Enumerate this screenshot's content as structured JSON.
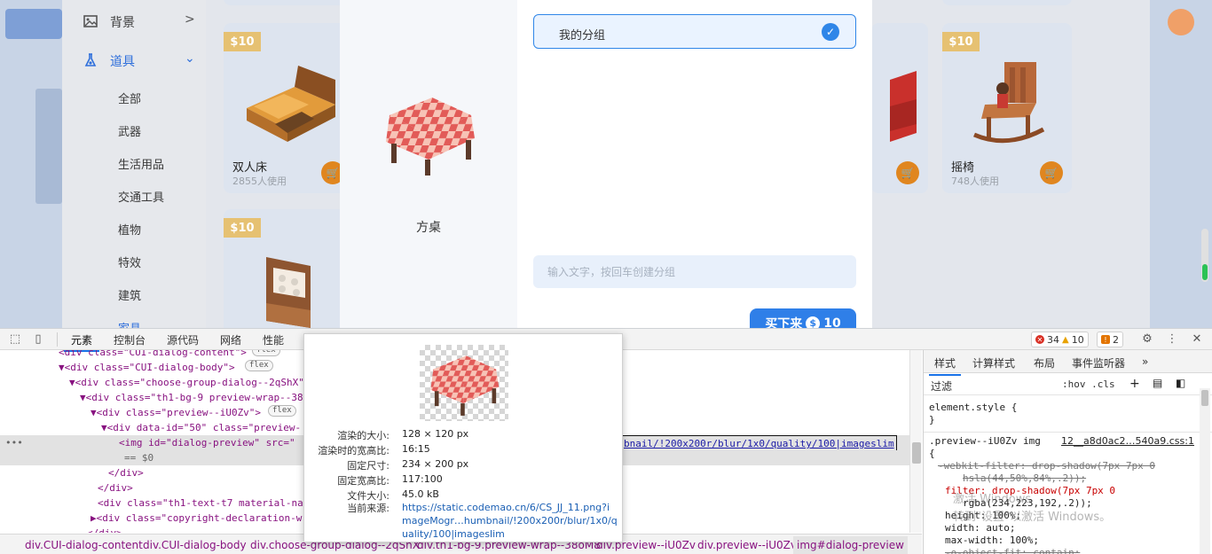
{
  "sidebar": {
    "items": [
      {
        "label": "背景",
        "icon": "image-icon"
      },
      {
        "label": "道具",
        "icon": "flask-icon"
      }
    ],
    "subitems": [
      "全部",
      "武器",
      "生活用品",
      "交通工具",
      "植物",
      "特效",
      "建筑",
      "家具"
    ]
  },
  "cards": [
    {
      "price": "$10",
      "name": "双人床",
      "users": "2855人使用"
    },
    {
      "price": "$10",
      "name": "",
      "users": ""
    },
    {
      "price": "$10",
      "name": "摇椅",
      "users": "748人使用"
    }
  ],
  "dialog": {
    "preview_title": "方桌",
    "group_label": "我的分组",
    "input_placeholder": "输入文字，按回车创建分组",
    "buy_label": "买下来",
    "buy_price": "10"
  },
  "devtools": {
    "tabs": [
      "元素",
      "控制台",
      "源代码",
      "网络",
      "性能"
    ],
    "errors": "34",
    "warnings": "10",
    "issues": "2",
    "dom_lines": [
      {
        "indent": 66,
        "html": "<div class=\"CUI-dialog-content\">",
        "badge": "flex"
      },
      {
        "indent": 66,
        "html": "▼<div class=\"CUI-dialog-body\">",
        "badge": "flex"
      },
      {
        "indent": 78,
        "html": "▼<div class=\"choose-group-dialog--2qShX\"",
        "badge": ""
      },
      {
        "indent": 90,
        "html": "▼<div class=\"th1-bg-9 preview-wrap--38",
        "badge": ""
      },
      {
        "indent": 102,
        "html": "▼<div class=\"preview--iU0Zv\">",
        "badge": "flex"
      },
      {
        "indent": 114,
        "html": "▼<div data-id=\"50\" class=\"preview-",
        "badge": ""
      },
      {
        "indent": 134,
        "html": "<img id=\"dialog-preview\" src=\"",
        "badge": ""
      },
      {
        "indent": 140,
        "html": "== $0",
        "badge": ""
      },
      {
        "indent": 122,
        "html": "</div>",
        "badge": ""
      },
      {
        "indent": 110,
        "html": "</div>",
        "badge": ""
      },
      {
        "indent": 110,
        "html": "<div class=\"th1-text-t7 material-nam",
        "badge": ""
      },
      {
        "indent": 102,
        "html": "▶<div class=\"copyright-declaration-w",
        "badge": ""
      },
      {
        "indent": 98,
        "html": "</div>",
        "badge": ""
      }
    ],
    "img_src_tail": "bnail/!200x200r/blur/1x0/quality/100|imageslim",
    "breadcrumb": [
      "div.CUI-dialog-content",
      "div.CUI-dialog-body",
      "div.choose-group-dialog--2qShX",
      "div.th1-bg-9.preview-wrap--38oM8",
      "div.preview--iU0Zv",
      "div.preview--iU0Zv",
      "img#dialog-preview"
    ],
    "styles_tabs": [
      "样式",
      "计算样式",
      "布局",
      "事件监听器"
    ],
    "filter_placeholder": "过滤",
    "hov_cls": ":hov  .cls",
    "element_style": "element.style {",
    "rule_selector": ".preview--iU0Zv img",
    "rule_source": "12__a8d0ac2…540a9.css:1",
    "css_lines": [
      "-webkit-filter: drop-shadow(7px 7px 0",
      "hsla(44,50%,84%,.2));",
      "filter: drop-shadow(7px 7px 0",
      "rgba(234,223,192,.2));",
      "height: 100%;",
      "width: auto;",
      "max-width: 100%;",
      "-o-object-fit: contain;"
    ],
    "watermark": "转到\"设置\"以激活 Windows。",
    "watermark_top": "激活 Windows"
  },
  "tooltip": {
    "rows": [
      {
        "key": "渲染的大小:",
        "val": "128 × 120 px"
      },
      {
        "key": "渲染时的宽高比:",
        "val": "16:15"
      },
      {
        "key": "固定尺寸:",
        "val": "234 × 200 px"
      },
      {
        "key": "固定宽高比:",
        "val": "117:100"
      },
      {
        "key": "文件大小:",
        "val": "45.0 kB"
      }
    ],
    "source_key": "当前来源:",
    "source_url": "https://static.codemao.cn/6/CS_JJ_11.png?imageMogr…humbnail/!200x200r/blur/1x0/quality/100|imageslim"
  }
}
